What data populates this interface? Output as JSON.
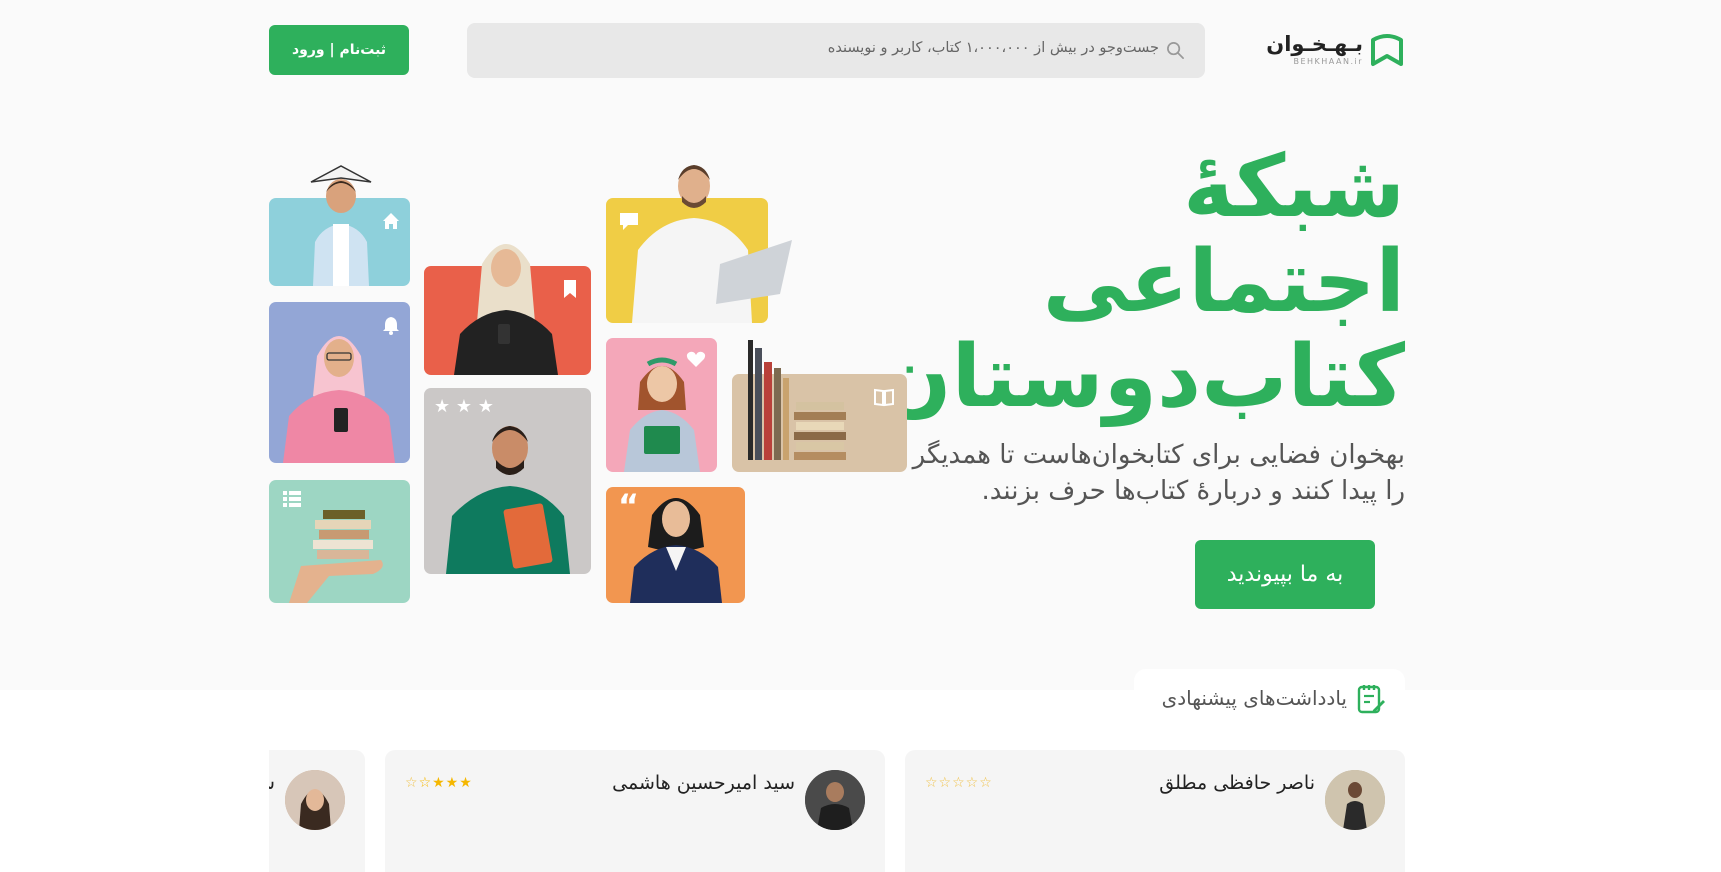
{
  "header": {
    "logo_text": "بـهـخـوان",
    "logo_sub": "BEHKHAAN.ir",
    "search_placeholder": "جست‌وجو در بیش از ۱،۰۰۰،۰۰۰ کتاب، کاربر و نویسنده",
    "login_label": "ثبت‌نام | ورود"
  },
  "hero": {
    "title_line1": "شبکهٔ",
    "title_line2": "اجتماعی",
    "title_line3": "کتاب‌دوستان",
    "desc_line1": "بهخوان فضایی برای کتابخوان‌هاست تا همدیگر",
    "desc_line2": "را پیدا کنند و دربارهٔ کتاب‌ها حرف بزنند.",
    "join_label": "به ما بپیوندید"
  },
  "colors": {
    "brand": "#2eb05c"
  },
  "recommended": {
    "section_title": "یادداشت‌های پیشنهادی",
    "section_icon": "note-pen-icon",
    "cards": [
      {
        "name": "ناصر حافظی مطلق",
        "rating": 0
      },
      {
        "name": "سید امیرحسین هاشمی",
        "rating": 3.5
      },
      {
        "name": "س",
        "rating": null
      }
    ]
  },
  "tiles": [
    {
      "color": "#8ed0db",
      "badge": "home-icon"
    },
    {
      "color": "#93a6d6",
      "badge": "bell-icon"
    },
    {
      "color": "#9dd6c3",
      "badge": "list-icon"
    },
    {
      "color": "#e9604a",
      "badge": "bookmark-icon"
    },
    {
      "color": "#cbc8c7",
      "badge": "stars-icon"
    },
    {
      "color": "#f0cd45",
      "badge": "comment-icon"
    },
    {
      "color": "#f4a7b9",
      "badge": "heart-icon"
    },
    {
      "color": "#f29650",
      "badge": "quote-icon"
    },
    {
      "color": "#d9c3a7",
      "badge": "book-open-icon"
    }
  ]
}
